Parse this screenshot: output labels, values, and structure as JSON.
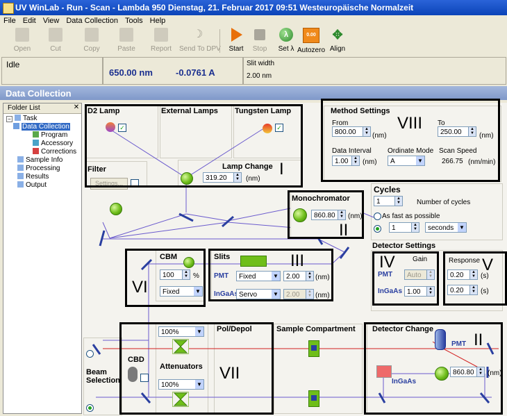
{
  "window": {
    "title": "UV WinLab - Run - Scan - Lambda 950 Dienstag, 21. Februar 2017 09:51 Westeuropäische Normalzeit"
  },
  "menu": [
    "File",
    "Edit",
    "View",
    "Data Collection",
    "Tools",
    "Help"
  ],
  "toolbar": {
    "open": "Open",
    "cut": "Cut",
    "copy": "Copy",
    "paste": "Paste",
    "report": "Report",
    "send": "Send To DPV",
    "start": "Start",
    "stop": "Stop",
    "setl": "Set λ",
    "autozero": "Autozero",
    "align": "Align",
    "autozero_icon_text": "0.00"
  },
  "status": {
    "state": "Idle",
    "wavelength": "650.00 nm",
    "absorbance": "-0.0761 A",
    "slit_label": "Slit width",
    "slit_value": "2.00 nm"
  },
  "section_title": "Data Collection",
  "folder": {
    "header": "Folder List",
    "items": [
      "Task",
      "Data Collection",
      "Program",
      "Accessory",
      "Corrections",
      "Sample Info",
      "Processing",
      "Results",
      "Output"
    ]
  },
  "d2lamp": {
    "title": "D2 Lamp"
  },
  "external": {
    "title": "External Lamps"
  },
  "tungsten": {
    "title": "Tungsten Lamp"
  },
  "filter": {
    "title": "Filter",
    "settings": "Settings..."
  },
  "lampchange": {
    "title": "Lamp Change",
    "value": "319.20",
    "unit": "(nm)"
  },
  "method": {
    "title": "Method Settings",
    "from_label": "From",
    "from_value": "800.00",
    "from_unit": "(nm)",
    "to_label": "To",
    "to_value": "250.00",
    "to_unit": "(nm)",
    "interval_label": "Data Interval",
    "interval_value": "1.00",
    "interval_unit": "(nm)",
    "ordinate_label": "Ordinate Mode",
    "ordinate_value": "A",
    "speed_label": "Scan Speed",
    "speed_value": "266.75",
    "speed_unit": "(nm/min)"
  },
  "mono": {
    "title": "Monochromator",
    "value": "860.80",
    "unit": "(nm)"
  },
  "cycles": {
    "title": "Cycles",
    "count": "1",
    "count_label": "Number of cycles",
    "fast_label": "As fast as possible",
    "interval": "1",
    "interval_unit": "seconds"
  },
  "detector_settings": {
    "title": "Detector Settings",
    "gain_label": "Gain",
    "pmt": "PMT",
    "pmt_gain": "Auto",
    "ingaas": "InGaAs",
    "ingaas_gain": "1.00",
    "response_label": "Response",
    "resp1": "0.20",
    "resp2": "0.20",
    "resp_unit": "(s)"
  },
  "cbm": {
    "title": "CBM",
    "value": "100",
    "unit": "%",
    "mode": "Fixed"
  },
  "slits": {
    "title": "Slits",
    "pmt": "PMT",
    "pmt_mode": "Fixed",
    "pmt_value": "2.00",
    "ingaas": "InGaAs",
    "ingaas_mode": "Servo",
    "ingaas_value": "2.00",
    "unit": "(nm)"
  },
  "poldepol": {
    "title": "Pol/Depol"
  },
  "sample": {
    "title": "Sample Compartment"
  },
  "detchange": {
    "title": "Detector Change",
    "pmt": "PMT",
    "ingaas": "InGaAs",
    "value": "860.80",
    "unit": "(nm)"
  },
  "atten": {
    "title": "Attenuators",
    "top": "100%",
    "bottom": "100%"
  },
  "cbd": "CBD",
  "beamsel": {
    "line1": "Beam",
    "line2": "Selection"
  },
  "annotations": {
    "I": "I",
    "II_mono": "II",
    "II_det": "II",
    "III": "III",
    "IV": "IV",
    "V": "V",
    "VI": "VI",
    "VII": "VII",
    "VIII": "VIII"
  },
  "colors": {
    "beam": "#6a5acd",
    "beam_red": "#d21f1f",
    "title_blue": "#0b44b8",
    "panel_bg": "#f4f3ee"
  }
}
